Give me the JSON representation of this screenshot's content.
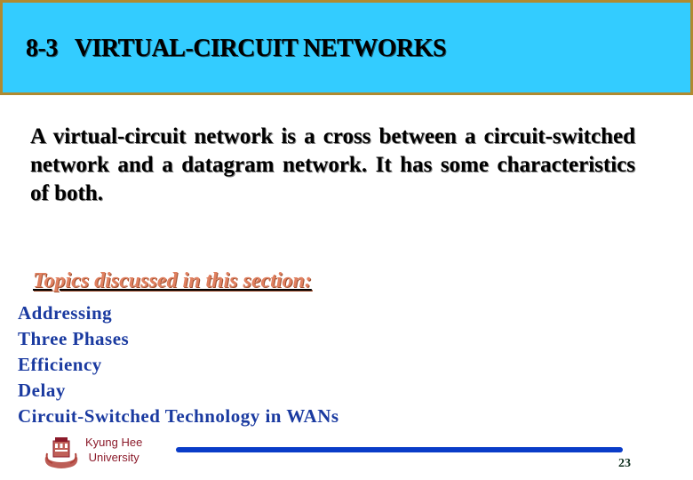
{
  "slide": {
    "title": "8-3   VIRTUAL-CIRCUIT NETWORKS",
    "intro": "A virtual-circuit network is a cross between a circuit-switched network and a datagram network. It has some characteristics of both.",
    "topics_heading": "Topics discussed in this section:",
    "topics": [
      "Addressing",
      "Three Phases",
      "Efficiency",
      "Delay",
      "Circuit-Switched Technology in WANs"
    ]
  },
  "footer": {
    "logo_icon": "university-seal-icon",
    "university_line1": "Kyung Hee",
    "university_line2": "University",
    "page_number": "23"
  },
  "colors": {
    "banner_bg": "#33ccff",
    "banner_border": "#b08a30",
    "topics_heading": "#e08060",
    "topics_text": "#1a3aa0",
    "footer_rule": "#0a3cc8",
    "university_text": "#8b1a2a"
  }
}
